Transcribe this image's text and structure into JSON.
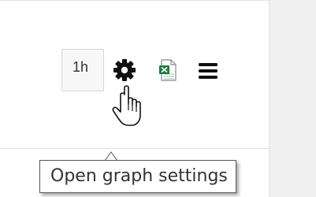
{
  "toolbar": {
    "range_label": "1h",
    "buttons": [
      {
        "icon": "gear-icon",
        "action": "open graph settings"
      },
      {
        "icon": "excel-icon",
        "badge": "X"
      },
      {
        "icon": "hamburger-menu-icon"
      }
    ]
  },
  "tooltip": {
    "text": "Open graph settings"
  },
  "colors": {
    "icon_dark": "#111111",
    "excel_green": "#1d7a3f",
    "panel_border": "#e3e3e3",
    "gutter": "#f0f0f0",
    "tooltip_border": "#5a5a5a"
  }
}
